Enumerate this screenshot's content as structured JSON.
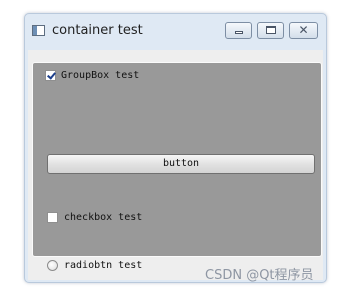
{
  "window": {
    "title": "container test",
    "minimize_icon": "minimize-icon",
    "maximize_icon": "maximize-icon",
    "close_icon": "close-icon",
    "close_glyph": "✕"
  },
  "groupbox": {
    "label": "GroupBox test",
    "checked": true,
    "background": "#999999"
  },
  "button": {
    "label": "button"
  },
  "checkbox": {
    "label": "checkbox test",
    "checked": false
  },
  "radio": {
    "label": "radiobtn test",
    "checked": false
  },
  "watermark": "CSDN @Qt程序员"
}
